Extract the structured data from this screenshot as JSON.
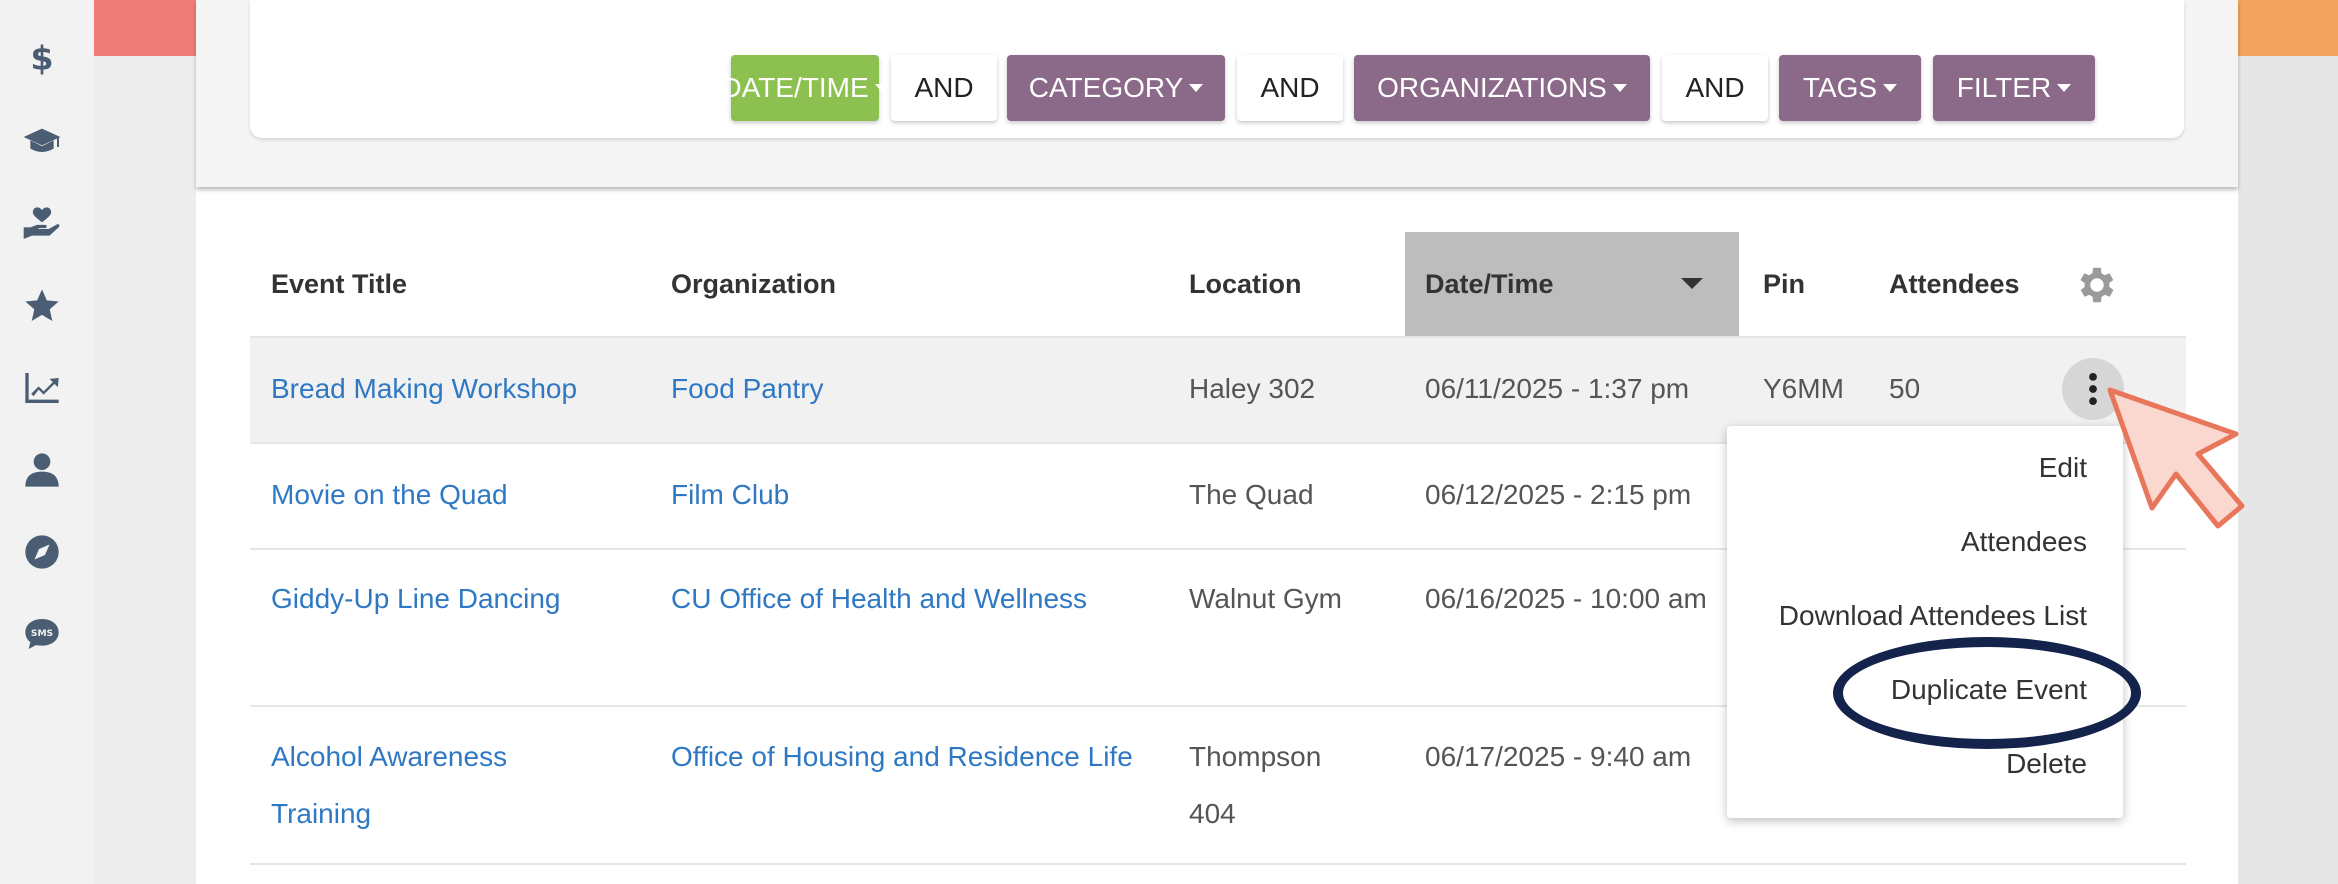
{
  "sidebar": {
    "icons": [
      "dollar-icon",
      "graduation-cap-icon",
      "heart-hand-icon",
      "star-icon",
      "chart-icon",
      "user-icon",
      "compass-icon",
      "sms-icon"
    ]
  },
  "filters": {
    "datetime_label": "DATE/TIME",
    "and1": "AND",
    "category_label": "CATEGORY",
    "and2": "AND",
    "organizations_label": "ORGANIZATIONS",
    "and3": "AND",
    "tags_label": "TAGS",
    "filter_label": "FILTER"
  },
  "table": {
    "headers": {
      "title": "Event Title",
      "organization": "Organization",
      "location": "Location",
      "datetime": "Date/Time",
      "pin": "Pin",
      "attendees": "Attendees"
    },
    "rows": [
      {
        "title": "Bread Making Workshop",
        "organization": "Food Pantry",
        "location": "Haley 302",
        "datetime": "06/11/2025 - 1:37 pm",
        "pin": "Y6MM",
        "attendees": "50"
      },
      {
        "title": "Movie on the Quad",
        "organization": "Film Club",
        "location": "The Quad",
        "datetime": "06/12/2025 - 2:15 pm",
        "pin": "",
        "attendees": ""
      },
      {
        "title": "Giddy-Up Line Dancing",
        "organization": "CU Office of Health and Wellness",
        "location": "Walnut Gym",
        "datetime": "06/16/2025 - 10:00 am",
        "pin": "",
        "attendees": ""
      },
      {
        "title": "Alcohol Awareness Training",
        "organization": "Office of Housing and Residence Life",
        "location": "Thompson 404",
        "datetime": "06/17/2025 - 9:40 am",
        "pin": "",
        "attendees": ""
      }
    ]
  },
  "menu": {
    "edit": "Edit",
    "attendees": "Attendees",
    "download": "Download Attendees List",
    "duplicate": "Duplicate Event",
    "delete": "Delete"
  },
  "colors": {
    "accent_green": "#8cc152",
    "accent_purple": "#8a6989",
    "link_blue": "#2f78c4",
    "highlight_ring": "#14234b",
    "cursor_fill": "#fbd8cf",
    "cursor_stroke": "#e8765a"
  }
}
